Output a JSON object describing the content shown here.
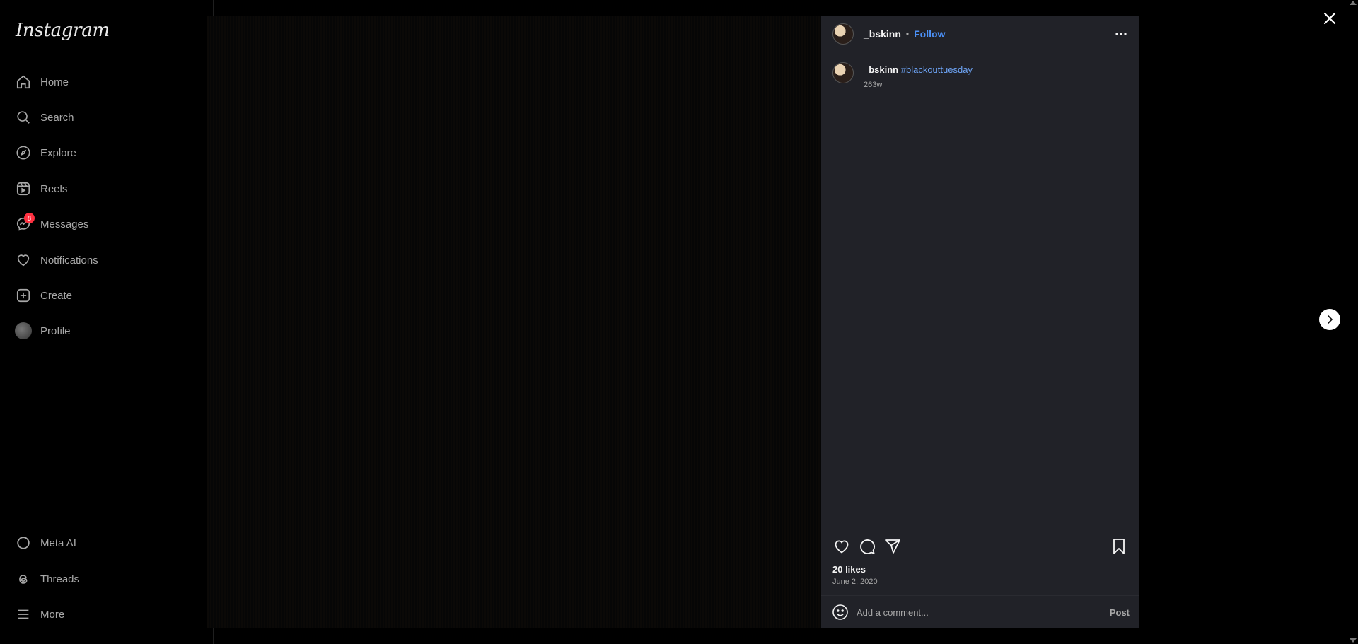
{
  "app": {
    "logo_text": "Instagram"
  },
  "sidebar": {
    "items": [
      {
        "label": "Home",
        "icon": "home-icon"
      },
      {
        "label": "Search",
        "icon": "search-icon"
      },
      {
        "label": "Explore",
        "icon": "compass-icon"
      },
      {
        "label": "Reels",
        "icon": "reels-icon"
      },
      {
        "label": "Messages",
        "icon": "messenger-icon",
        "badge": "8"
      },
      {
        "label": "Notifications",
        "icon": "heart-icon"
      },
      {
        "label": "Create",
        "icon": "plus-square-icon"
      },
      {
        "label": "Profile",
        "icon": "avatar"
      }
    ],
    "bottom_items": [
      {
        "label": "Meta AI",
        "icon": "meta-ai-icon"
      },
      {
        "label": "Threads",
        "icon": "threads-icon"
      },
      {
        "label": "More",
        "icon": "hamburger-icon"
      }
    ]
  },
  "post": {
    "author": "_bskinn",
    "separator": "•",
    "follow_label": "Follow",
    "caption_user": "_bskinn",
    "caption_hashtag": "#blackouttuesday",
    "caption_age": "263w",
    "likes": "20 likes",
    "date": "June 2, 2020",
    "comment_placeholder": "Add a comment...",
    "post_label": "Post"
  },
  "colors": {
    "link": "#4b90f7",
    "panel_bg": "#212228",
    "badge": "#ff3040"
  }
}
